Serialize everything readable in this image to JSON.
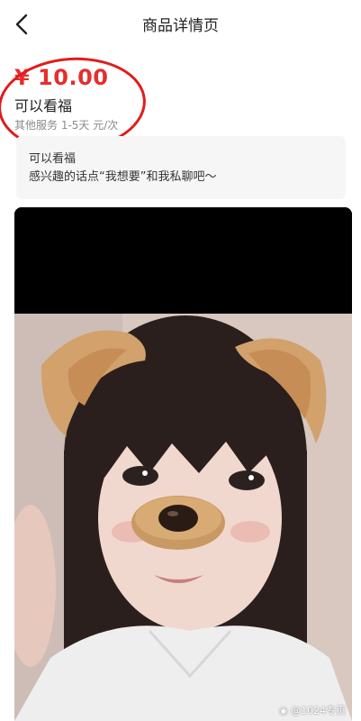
{
  "header": {
    "title": "商品详情页"
  },
  "product": {
    "price": "¥ 10.00",
    "name": "可以看福",
    "meta": "其他服务  1-5天  元/次"
  },
  "description": {
    "line1": "可以看福",
    "line2": "感兴趣的话点“我想要”和我私聊吧～"
  },
  "photo": {
    "alt": "selfie with dog-ear filter"
  },
  "watermark": {
    "text": "@1024专页"
  },
  "colors": {
    "price": "#e52e2e",
    "highlight_circle": "#e21b1b",
    "card_bg": "#f6f6f6"
  },
  "icons": {
    "back": "chevron-left-icon",
    "weibo": "weibo-icon"
  }
}
